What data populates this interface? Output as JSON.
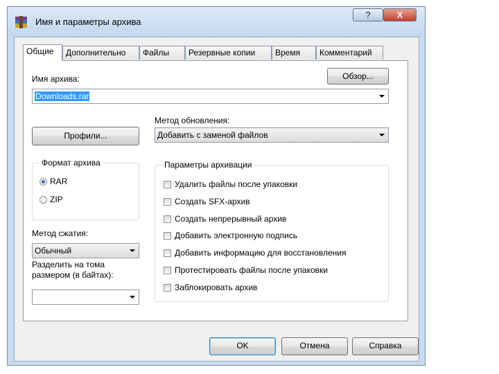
{
  "window": {
    "title": "Имя и параметры архива",
    "help_label": "?",
    "close_label": "X"
  },
  "tabs": [
    {
      "label": "Общие",
      "active": true
    },
    {
      "label": "Дополнительно"
    },
    {
      "label": "Файлы"
    },
    {
      "label": "Резервные копии"
    },
    {
      "label": "Время"
    },
    {
      "label": "Комментарий"
    }
  ],
  "archive": {
    "name_label": "Имя архива:",
    "name_value": "Downloads.rar",
    "browse_label": "Обзор..."
  },
  "profiles_label": "Профили...",
  "update_method": {
    "label": "Метод обновления:",
    "value": "Добавить с заменой файлов"
  },
  "format": {
    "legend": "Формат архива",
    "options": [
      {
        "label": "RAR",
        "selected": true
      },
      {
        "label": "ZIP",
        "selected": false
      }
    ]
  },
  "compression": {
    "label": "Метод сжатия:",
    "value": "Обычный"
  },
  "split": {
    "label": "Разделить на тома размером (в байтах):",
    "value": ""
  },
  "options": {
    "legend": "Параметры архивации",
    "items": [
      {
        "label": "Удалить файлы после упаковки",
        "checked": false
      },
      {
        "label": "Создать SFX-архив",
        "checked": false
      },
      {
        "label": "Создать непрерывный архив",
        "checked": false
      },
      {
        "label": "Добавить электронную подпись",
        "checked": false
      },
      {
        "label": "Добавить информацию для восстановления",
        "checked": false
      },
      {
        "label": "Протестировать файлы после упаковки",
        "checked": false
      },
      {
        "label": "Заблокировать архив",
        "checked": false
      }
    ]
  },
  "buttons": {
    "ok": "OK",
    "cancel": "Отмена",
    "help": "Справка"
  },
  "colors": {
    "frame": "#c8dbf0",
    "selection": "#3399ff",
    "radio_dot": "#2f6ec0",
    "close": "#c0402c"
  }
}
